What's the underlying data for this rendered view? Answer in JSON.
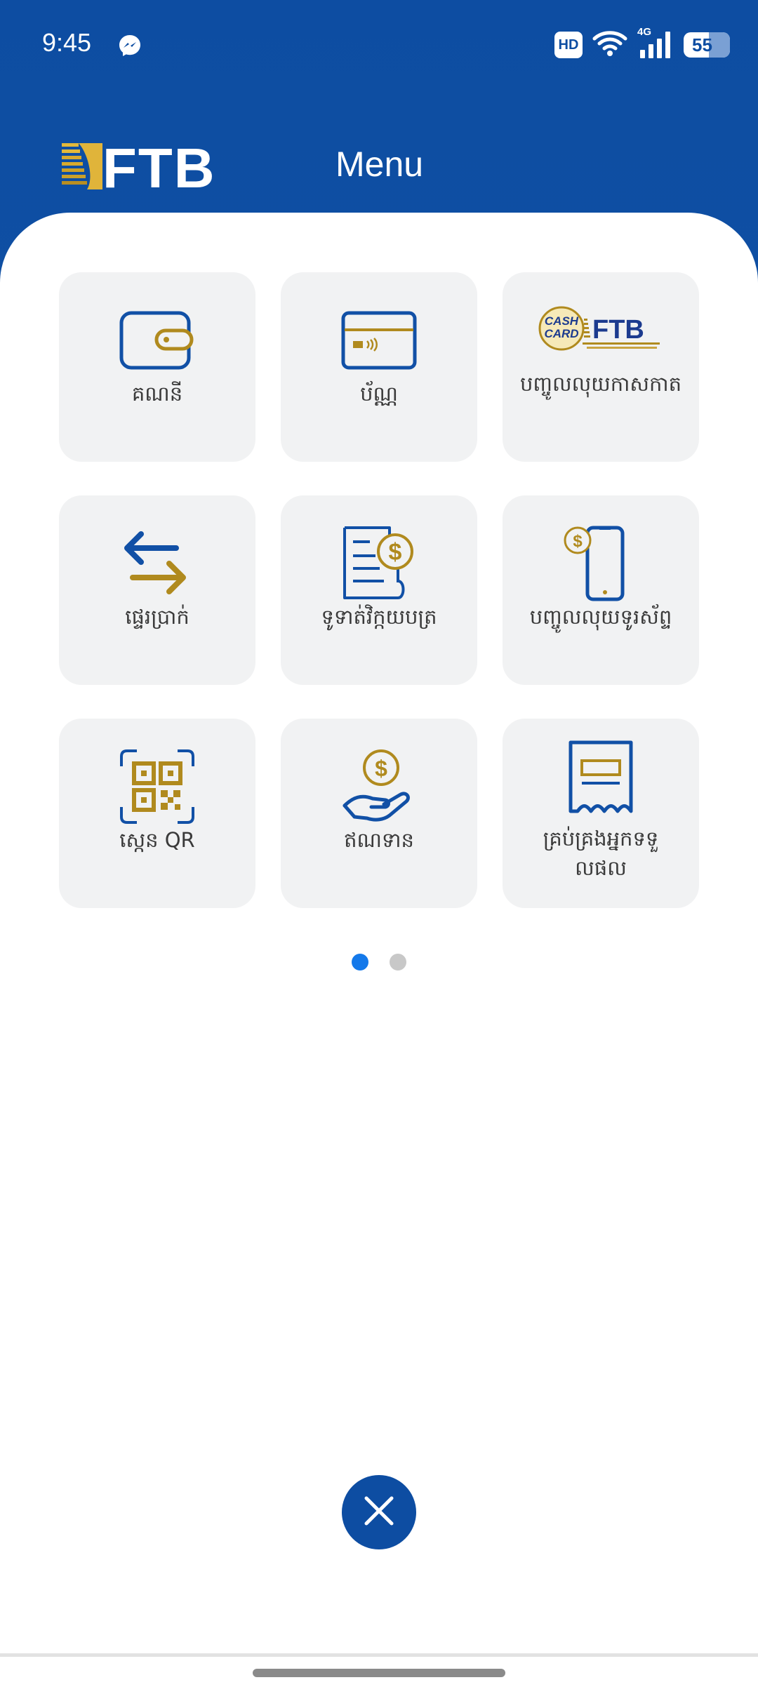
{
  "status_bar": {
    "time": "9:45",
    "hd": "HD",
    "network": "4G",
    "battery": "55",
    "messenger_icon": "messenger-icon",
    "wifi_icon": "wifi-icon",
    "signal_icon": "signal-icon"
  },
  "header": {
    "logo_text": "FTB",
    "title": "Menu"
  },
  "menu": {
    "items": [
      {
        "label": "គណនី",
        "icon": "wallet-icon"
      },
      {
        "label": "ប័ណ្ណ",
        "icon": "card-icon"
      },
      {
        "label": "បញ្ចូលលុយកាសកាត",
        "icon": "cash-card-logo-icon",
        "logo_text": "CASH CARD FTB"
      },
      {
        "label": "ផ្ទេរប្រាក់",
        "icon": "transfer-arrows-icon"
      },
      {
        "label": "ទូទាត់វិក្កយបត្រ",
        "icon": "bill-payment-icon"
      },
      {
        "label": "បញ្ចូលលុយទូរស័ព្ទ",
        "icon": "mobile-topup-icon"
      },
      {
        "label": "ស្កេន QR",
        "icon": "qr-scan-icon"
      },
      {
        "label": "ឥណទាន",
        "icon": "loan-hand-icon"
      },
      {
        "label": "គ្រប់គ្រងអ្នកទទួលផល",
        "icon": "beneficiary-receipt-icon"
      }
    ]
  },
  "pager": {
    "pages": 2,
    "current": 1
  },
  "colors": {
    "brand_blue": "#0d4da2",
    "gold": "#b08a1e",
    "tile_bg": "#f1f2f3",
    "active_dot": "#1479ea"
  },
  "close_icon": "close-icon"
}
